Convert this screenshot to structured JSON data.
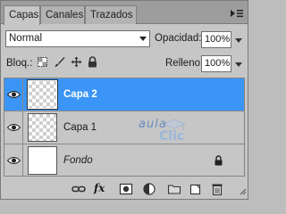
{
  "tabs": [
    {
      "label": "Capas",
      "active": true
    },
    {
      "label": "Canales",
      "active": false
    },
    {
      "label": "Trazados",
      "active": false
    }
  ],
  "blend": {
    "value": "Normal"
  },
  "opacity": {
    "label": "Opacidad:",
    "value": "100%"
  },
  "lock": {
    "label": "Bloq.:",
    "icons": [
      "lock-transparent-icon",
      "lock-brush-icon",
      "lock-move-icon",
      "lock-all-icon"
    ]
  },
  "fill": {
    "label": "Relleno:",
    "value": "100%"
  },
  "layers": [
    {
      "name": "Capa 2",
      "selected": true,
      "visible": true,
      "thumbnail": "transparent"
    },
    {
      "name": "Capa 1",
      "selected": false,
      "visible": true,
      "thumbnail": "transparent"
    },
    {
      "name": "Fondo",
      "selected": false,
      "visible": true,
      "thumbnail": "white",
      "locked": true
    }
  ],
  "watermark": {
    "line1": "aula",
    "line2": "Clic"
  },
  "bottom_tools": [
    "link-layers-icon",
    "fx-icon",
    "layer-mask-icon",
    "adjustment-layer-icon",
    "new-group-icon",
    "new-layer-icon",
    "trash-icon"
  ],
  "fx_label": "fx",
  "colors": {
    "selection": "#3b95f7",
    "panel": "#c6c6c6",
    "tabbar": "#9d9d9d"
  }
}
